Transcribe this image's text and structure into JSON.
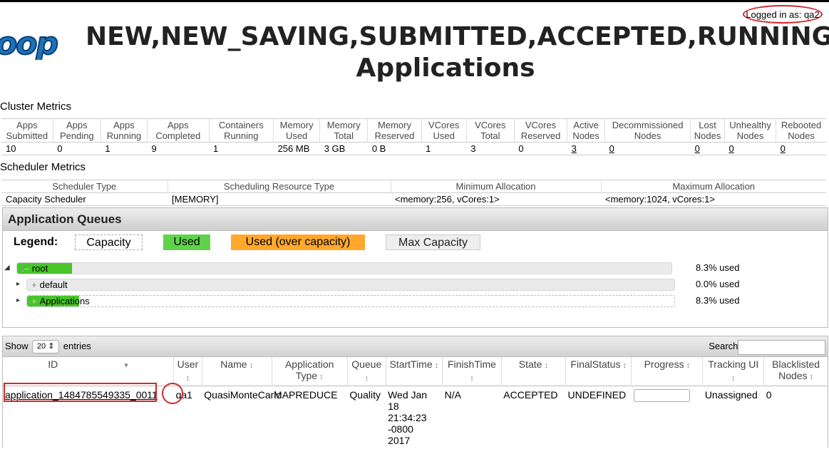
{
  "header": {
    "title_line1": "NEW,NEW_SAVING,SUBMITTED,ACCEPTED,RUNNING",
    "title_line2": "Applications",
    "logged_in": "Logged in as: qa2",
    "logo_text": "oop"
  },
  "cluster_metrics": {
    "label": "Cluster Metrics",
    "headers": [
      "Apps Submitted",
      "Apps Pending",
      "Apps Running",
      "Apps Completed",
      "Containers Running",
      "Memory Used",
      "Memory Total",
      "Memory Reserved",
      "VCores Used",
      "VCores Total",
      "VCores Reserved",
      "Active Nodes",
      "Decommissioned Nodes",
      "Lost Nodes",
      "Unhealthy Nodes",
      "Rebooted Nodes"
    ],
    "values": [
      "10",
      "0",
      "1",
      "9",
      "1",
      "256 MB",
      "3 GB",
      "0 B",
      "1",
      "3",
      "0",
      "3",
      "0",
      "0",
      "0",
      "0"
    ]
  },
  "scheduler_metrics": {
    "label": "Scheduler Metrics",
    "headers": [
      "Scheduler Type",
      "Scheduling Resource Type",
      "Minimum Allocation",
      "Maximum Allocation"
    ],
    "values": [
      "Capacity Scheduler",
      "[MEMORY]",
      "<memory:256, vCores:1>",
      "<memory:1024, vCores:1>"
    ]
  },
  "queues": {
    "title": "Application Queues",
    "legend": {
      "label": "Legend:",
      "capacity": "Capacity",
      "used": "Used",
      "over": "Used (over capacity)",
      "max": "Max Capacity"
    },
    "items": [
      {
        "name": "root",
        "prefix": ".–",
        "pct_text": "8.3% used",
        "used": 0.083
      },
      {
        "name": "default",
        "prefix": "+",
        "pct_text": "0.0% used",
        "used": 0.0
      },
      {
        "name": "Applications",
        "prefix": "+",
        "pct_text": "8.3% used",
        "used": 0.083
      }
    ],
    "colors": {
      "used": "#49c52a",
      "over": "#ffa82b"
    }
  },
  "apps_table": {
    "show_label": "Show",
    "entries_value": "20",
    "entries_label": "entries",
    "search_label": "Search:",
    "search_value": "",
    "headers": [
      "ID",
      "User",
      "Name",
      "Application Type",
      "Queue",
      "StartTime",
      "FinishTime",
      "State",
      "FinalStatus",
      "Progress",
      "Tracking UI",
      "Blacklisted Nodes"
    ],
    "rows": [
      {
        "id": "application_1484785549335_0011",
        "user": "qa1",
        "name": "QuasiMonteCarlo",
        "type": "MAPREDUCE",
        "queue": "Quality",
        "start": "Wed Jan 18 21:34:23 -0800 2017",
        "finish": "N/A",
        "state": "ACCEPTED",
        "final_status": "UNDEFINED",
        "progress": 0.0,
        "tracking": "Unassigned",
        "blacklisted": "0"
      }
    ]
  }
}
